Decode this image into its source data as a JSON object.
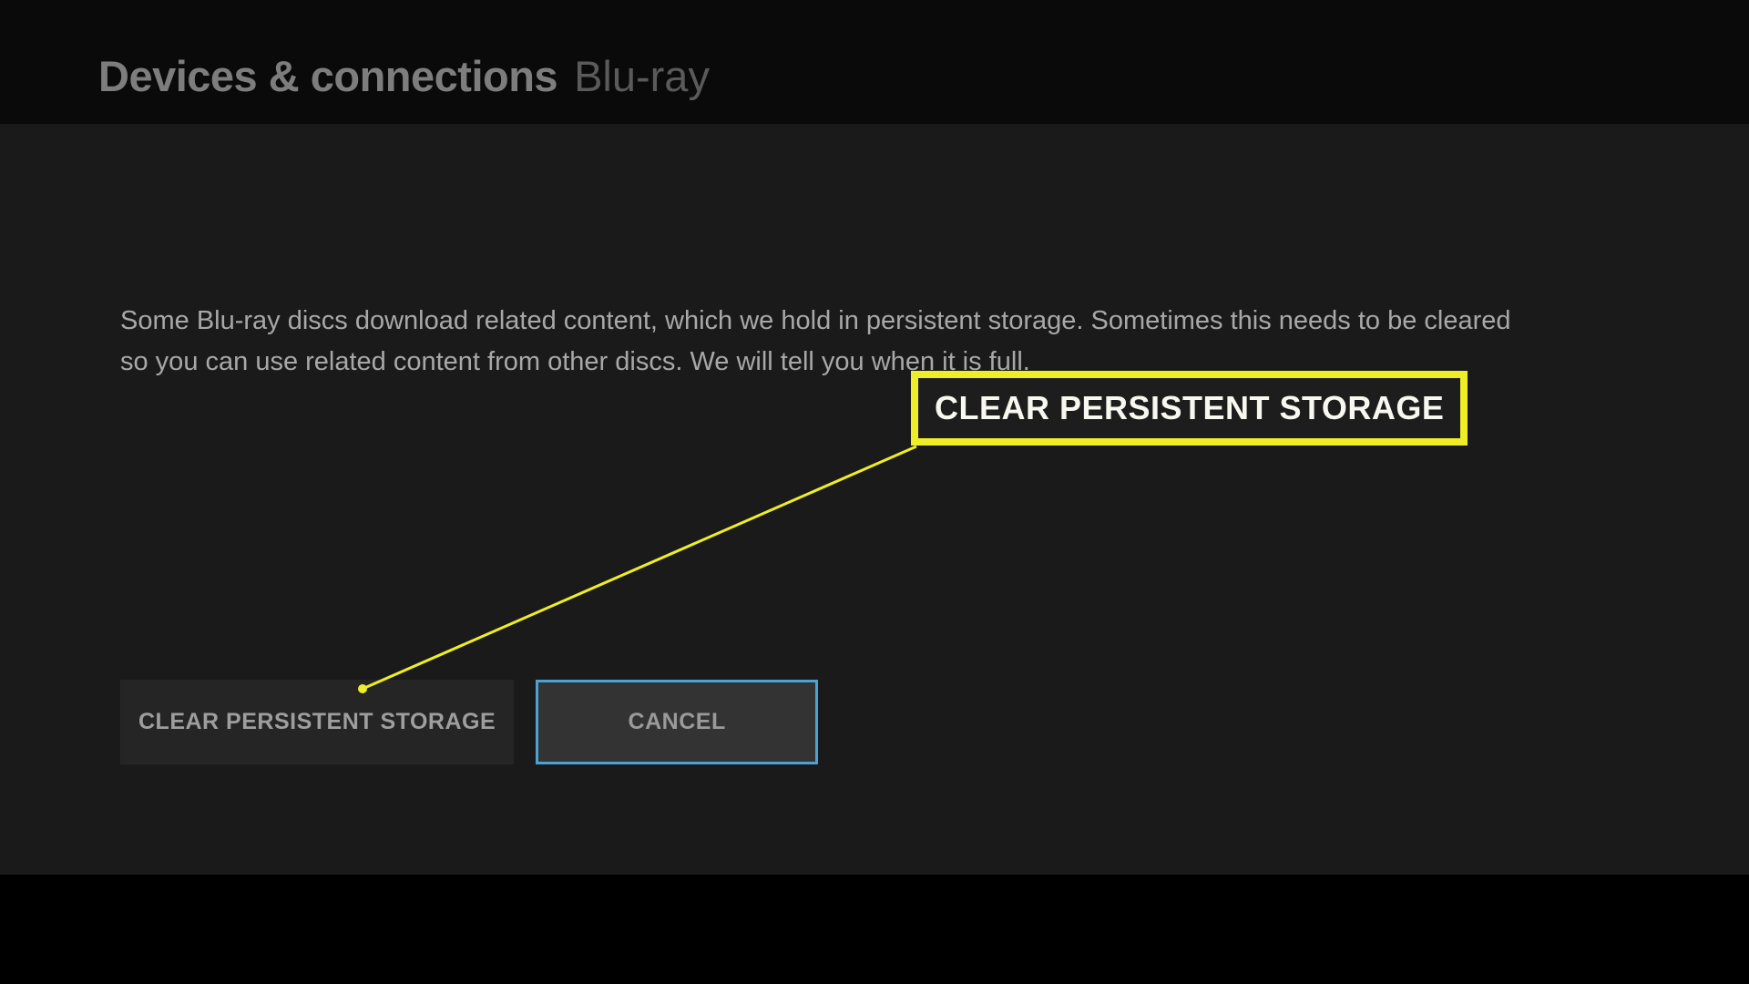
{
  "header": {
    "main_title": "Devices & connections",
    "sub_title": "Blu-ray"
  },
  "content": {
    "description": "Some Blu-ray discs download related content, which we hold in persistent storage.  Sometimes this needs to be cleared so you can use related content from other discs. We will tell you when it is full."
  },
  "buttons": {
    "clear_label": "CLEAR PERSISTENT STORAGE",
    "cancel_label": "CANCEL"
  },
  "callout": {
    "label": "CLEAR PERSISTENT STORAGE"
  },
  "colors": {
    "highlight": "#eeed27",
    "focus_border": "#4aa3d6"
  }
}
